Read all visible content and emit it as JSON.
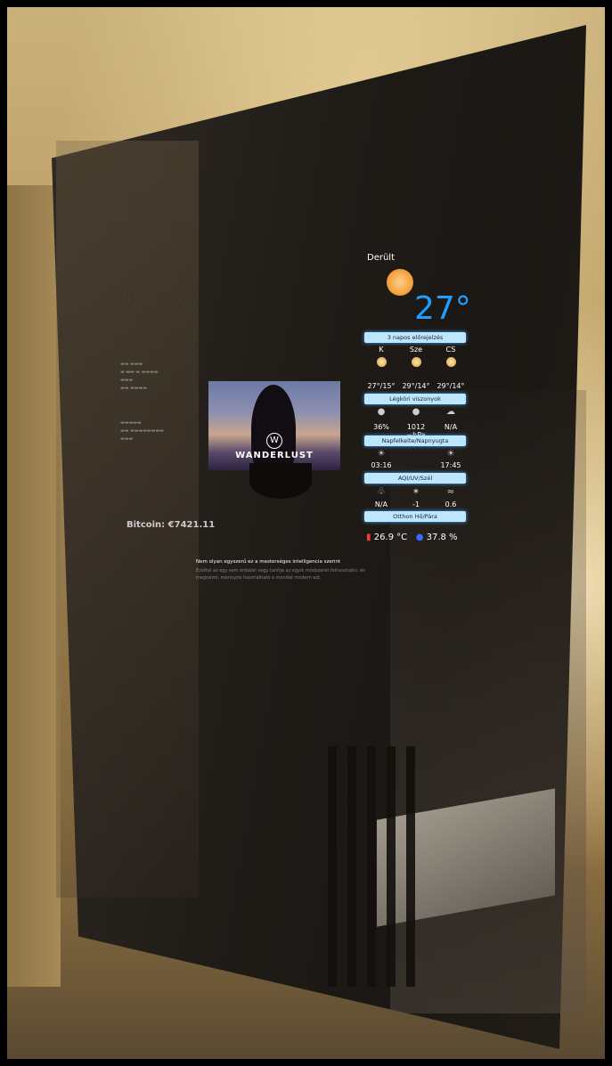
{
  "bitcoin": "Bitcoin: €7421.11",
  "video": {
    "brand": "WANDERLUST"
  },
  "news": {
    "headline": "Nem olyan egyszerű ez a mesterséges intelligencia szerint",
    "body": "Ezúttal az egy sem érdekel vagy tanítja az egyik módszerét felhasználni, és megnézni, mennyire használható a mondat modern ezt."
  },
  "weather": {
    "condition": "Derült",
    "temperature": "27°",
    "forecast_header": "3 napos előrejelzés",
    "days": [
      "K",
      "Sze",
      "CS"
    ],
    "temps": [
      "27°/15°",
      "29°/14°",
      "29°/14°"
    ],
    "atmos_header": "Légköri viszonyok",
    "atmos_values": [
      "36%",
      "1012 ~hPa",
      "N/A"
    ],
    "sun_header": "Napfelkelte/Napnyugta",
    "sun_values": [
      "03:16",
      "17:45"
    ],
    "aqi_header": "AQI/UV/Szél",
    "aqi_values": [
      "N/A",
      "-1",
      "0.6"
    ],
    "indoor_header": "Otthon Hő/Pára"
  },
  "indoor": {
    "temp": "26.9 °C",
    "humidity": "37.8 %"
  },
  "colors": {
    "accent": "#1e9cff",
    "bar": "#bfe6ff"
  }
}
